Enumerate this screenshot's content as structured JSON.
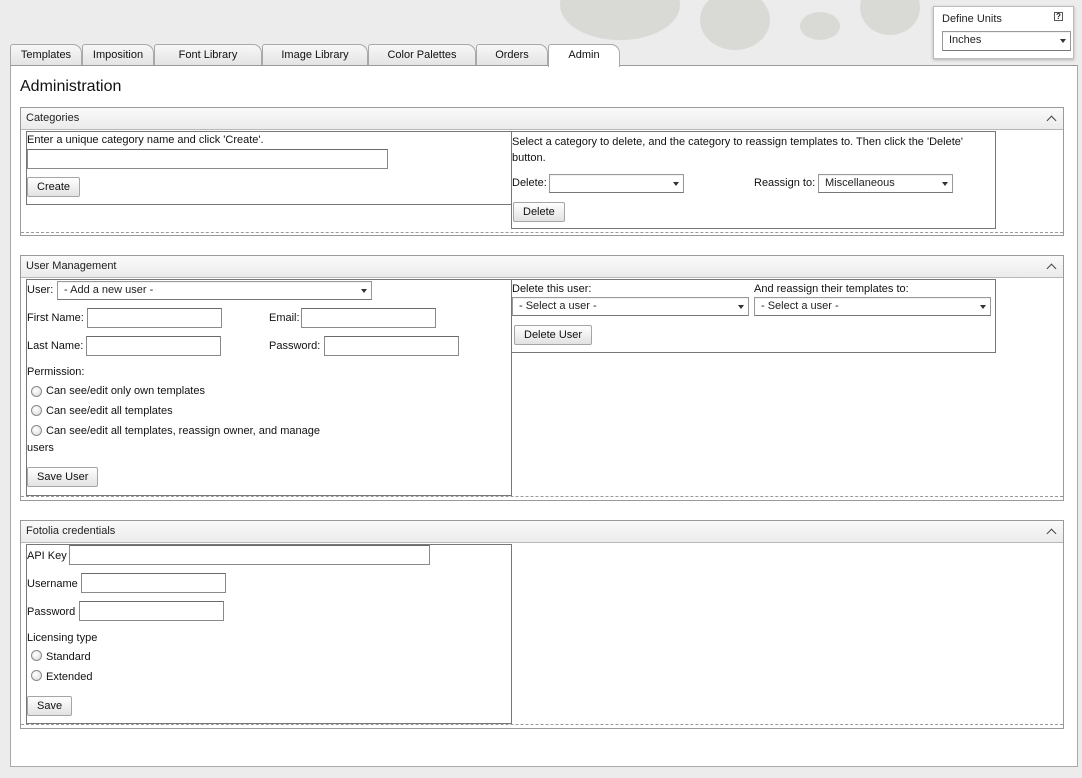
{
  "units": {
    "title": "Define Units",
    "help": "?",
    "selected": "Inches"
  },
  "tabs": [
    "Templates",
    "Imposition",
    "Font Library",
    "Image Library",
    "Color Palettes",
    "Orders",
    "Admin"
  ],
  "active_tab": "Admin",
  "page_title": "Administration",
  "categories": {
    "title": "Categories",
    "create_instructions": "Enter a unique category name and click 'Create'.",
    "create_value": "",
    "create_button": "Create",
    "delete_instructions": "Select a category to delete, and the category to reassign templates to. Then click the 'Delete' button.",
    "delete_label": "Delete:",
    "delete_selected": "",
    "reassign_label": "Reassign to:",
    "reassign_selected": "Miscellaneous",
    "delete_button": "Delete"
  },
  "users": {
    "title": "User Management",
    "user_label": "User:",
    "user_selected": "- Add a new user -",
    "first_name_label": "First Name:",
    "first_name_value": "",
    "email_label": "Email:",
    "email_value": "",
    "last_name_label": "Last Name:",
    "last_name_value": "",
    "password_label": "Password:",
    "password_value": "",
    "permission_label": "Permission:",
    "permissions": [
      "Can see/edit only own templates",
      "Can see/edit all templates",
      "Can see/edit all templates, reassign owner, and manage"
    ],
    "permission_wrap": "users",
    "save_button": "Save User",
    "delete_user_label": "Delete this user:",
    "delete_user_selected": "- Select a user -",
    "reassign_label": "And reassign their templates to:",
    "reassign_selected": "- Select a user -",
    "delete_button": "Delete User"
  },
  "fotolia": {
    "title": "Fotolia credentials",
    "api_key_label": "API Key",
    "api_key_value": "",
    "username_label": "Username",
    "username_value": "",
    "password_label": "Password",
    "password_value": "",
    "licensing_label": "Licensing type",
    "licensing_options": [
      "Standard",
      "Extended"
    ],
    "save_button": "Save"
  },
  "colors": {
    "background": "#ececec",
    "panel": "#ffffff",
    "border": "#9a9a9a"
  }
}
